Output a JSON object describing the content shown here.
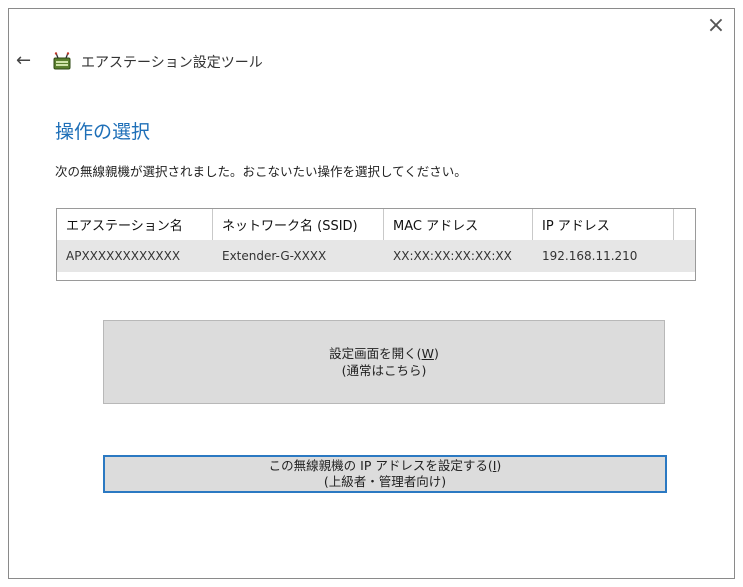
{
  "window": {
    "close_label": "×",
    "back_label": "←",
    "app_title": "エアステーション設定ツール",
    "icon": "router-icon"
  },
  "page": {
    "heading": "操作の選択",
    "instruction": "次の無線親機が選択されました。おこないたい操作を選択してください。"
  },
  "table": {
    "headers": [
      "エアステーション名",
      "ネットワーク名 (SSID)",
      "MAC アドレス",
      "IP アドレス",
      ""
    ],
    "rows": [
      [
        "APXXXXXXXXXXXX",
        "Extender-G-XXXX",
        "XX:XX:XX:XX:XX:XX",
        "192.168.11.210",
        ""
      ]
    ]
  },
  "buttons": {
    "open_settings": {
      "line1": "設定画面を開く(",
      "accel": "W",
      "line1_end": ")",
      "line2": "(通常はこちら)"
    },
    "set_ip": {
      "line1": "この無線親機の IP アドレスを設定する(",
      "accel": "I",
      "line1_end": ")",
      "line2": "(上級者・管理者向け)"
    }
  },
  "colors": {
    "heading": "#1e6fb8",
    "focus_border": "#2b79c2",
    "button_bg": "#dcdcdc",
    "row_bg": "#e6e6e6"
  }
}
